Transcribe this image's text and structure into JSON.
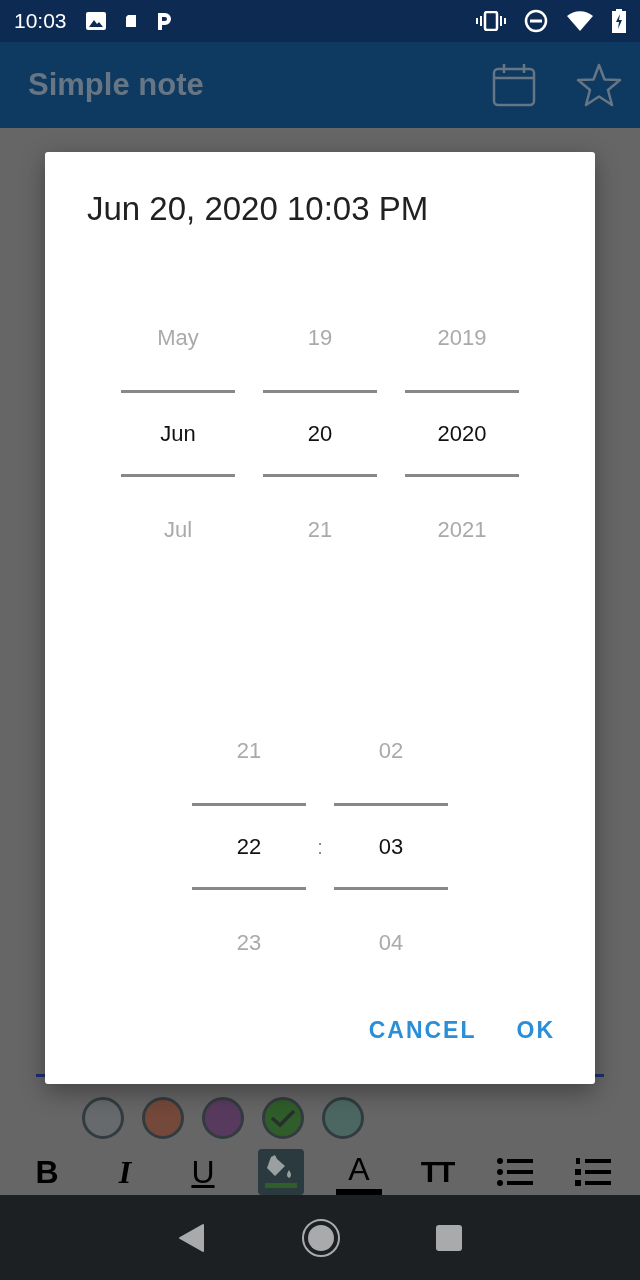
{
  "status_bar": {
    "time": "10:03"
  },
  "app_bar": {
    "title": "Simple note"
  },
  "dialog": {
    "title": "Jun 20, 2020 10:03 PM",
    "date_pickers": [
      {
        "previous": "May",
        "value": "Jun",
        "next": "Jul"
      },
      {
        "previous": "19",
        "value": "20",
        "next": "21"
      },
      {
        "previous": "2019",
        "value": "2020",
        "next": "2021"
      }
    ],
    "time_pickers": [
      {
        "previous": "21",
        "value": "22",
        "next": "23"
      },
      {
        "previous": "02",
        "value": "03",
        "next": "04"
      }
    ],
    "separator": ":",
    "buttons": [
      "CANCEL",
      "OK"
    ]
  },
  "colors": [
    {
      "color": "#666a6c",
      "selected": false
    },
    {
      "color": "#74483a",
      "selected": false
    },
    {
      "color": "#583a5e",
      "selected": false
    },
    {
      "color": "#2f5e2a",
      "selected": true
    },
    {
      "color": "#4c6762",
      "selected": false
    }
  ],
  "toolbar": [
    {
      "kind": "bold",
      "label": "B",
      "selected": false
    },
    {
      "kind": "italic",
      "label": "I",
      "selected": false
    },
    {
      "kind": "underline",
      "label": "U",
      "selected": false
    },
    {
      "kind": "fill",
      "selected": true
    },
    {
      "kind": "textcolor",
      "label": "A",
      "selected": false
    },
    {
      "kind": "size",
      "label": "TT",
      "selected": false
    },
    {
      "kind": "bullets",
      "selected": false
    },
    {
      "kind": "numbers",
      "selected": false
    }
  ]
}
